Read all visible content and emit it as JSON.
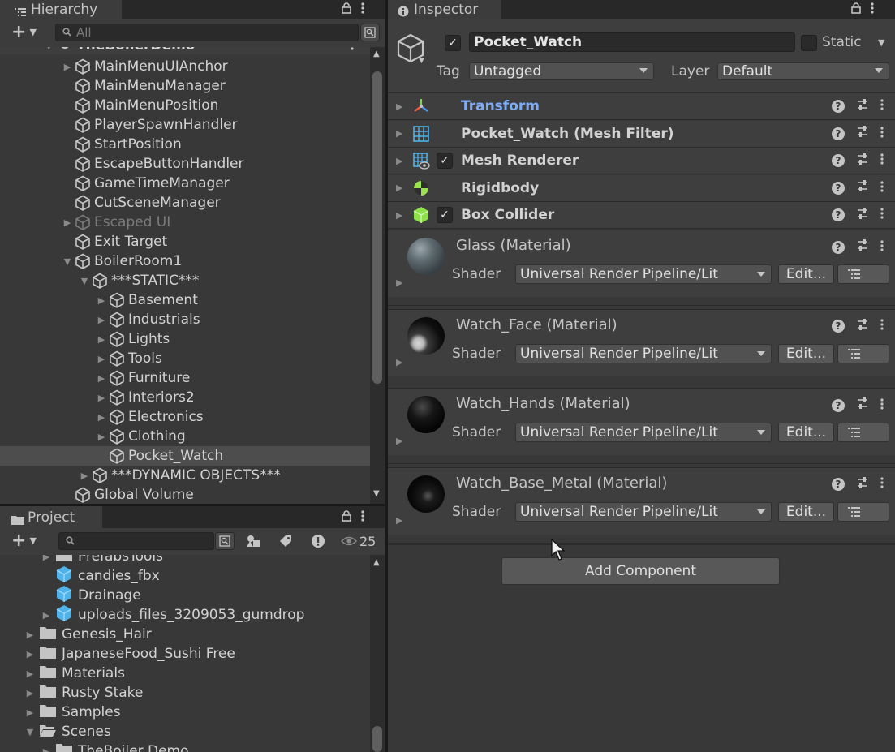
{
  "hierarchy": {
    "tab_label": "Hierarchy",
    "search_placeholder": "All",
    "scene_name": "TheBoilerDemo",
    "rows": [
      {
        "label": "MainMenuUIAnchor",
        "depth": 1,
        "arrow": "right",
        "dim": false,
        "selected": false
      },
      {
        "label": "MainMenuManager",
        "depth": 1,
        "arrow": "",
        "dim": false,
        "selected": false
      },
      {
        "label": "MainMenuPosition",
        "depth": 1,
        "arrow": "",
        "dim": false,
        "selected": false
      },
      {
        "label": "PlayerSpawnHandler",
        "depth": 1,
        "arrow": "",
        "dim": false,
        "selected": false
      },
      {
        "label": "StartPosition",
        "depth": 1,
        "arrow": "",
        "dim": false,
        "selected": false
      },
      {
        "label": "EscapeButtonHandler",
        "depth": 1,
        "arrow": "",
        "dim": false,
        "selected": false
      },
      {
        "label": "GameTimeManager",
        "depth": 1,
        "arrow": "",
        "dim": false,
        "selected": false
      },
      {
        "label": "CutSceneManager",
        "depth": 1,
        "arrow": "",
        "dim": false,
        "selected": false
      },
      {
        "label": "Escaped UI",
        "depth": 1,
        "arrow": "right",
        "dim": true,
        "selected": false
      },
      {
        "label": "Exit Target",
        "depth": 1,
        "arrow": "",
        "dim": false,
        "selected": false
      },
      {
        "label": "BoilerRoom1",
        "depth": 1,
        "arrow": "down",
        "dim": false,
        "selected": false
      },
      {
        "label": "***STATIC***",
        "depth": 2,
        "arrow": "down",
        "dim": false,
        "selected": false
      },
      {
        "label": "Basement",
        "depth": 3,
        "arrow": "right",
        "dim": false,
        "selected": false
      },
      {
        "label": "Industrials",
        "depth": 3,
        "arrow": "right",
        "dim": false,
        "selected": false
      },
      {
        "label": "Lights",
        "depth": 3,
        "arrow": "right",
        "dim": false,
        "selected": false
      },
      {
        "label": "Tools",
        "depth": 3,
        "arrow": "right",
        "dim": false,
        "selected": false
      },
      {
        "label": "Furniture",
        "depth": 3,
        "arrow": "right",
        "dim": false,
        "selected": false
      },
      {
        "label": "Interiors2",
        "depth": 3,
        "arrow": "right",
        "dim": false,
        "selected": false
      },
      {
        "label": "Electronics",
        "depth": 3,
        "arrow": "right",
        "dim": false,
        "selected": false
      },
      {
        "label": "Clothing",
        "depth": 3,
        "arrow": "right",
        "dim": false,
        "selected": false
      },
      {
        "label": "Pocket_Watch",
        "depth": 3,
        "arrow": "",
        "dim": false,
        "selected": true
      },
      {
        "label": "***DYNAMIC OBJECTS***",
        "depth": 2,
        "arrow": "right",
        "dim": false,
        "selected": false
      },
      {
        "label": "Global Volume",
        "depth": 1,
        "arrow": "",
        "dim": false,
        "selected": false
      }
    ]
  },
  "project": {
    "tab_label": "Project",
    "hidden_count": "25",
    "items": [
      {
        "label": "PrefabsTools",
        "indent": 1,
        "arrow": "right",
        "icon": "folder"
      },
      {
        "label": "candies_fbx",
        "indent": 1,
        "arrow": "",
        "icon": "model"
      },
      {
        "label": "Drainage",
        "indent": 1,
        "arrow": "",
        "icon": "model"
      },
      {
        "label": "uploads_files_3209053_gumdrop",
        "indent": 1,
        "arrow": "right",
        "icon": "model"
      },
      {
        "label": "Genesis_Hair",
        "indent": 0,
        "arrow": "right",
        "icon": "folder"
      },
      {
        "label": "JapaneseFood_Sushi Free",
        "indent": 0,
        "arrow": "right",
        "icon": "folder"
      },
      {
        "label": "Materials",
        "indent": 0,
        "arrow": "right",
        "icon": "folder"
      },
      {
        "label": "Rusty Stake",
        "indent": 0,
        "arrow": "right",
        "icon": "folder"
      },
      {
        "label": "Samples",
        "indent": 0,
        "arrow": "right",
        "icon": "folder"
      },
      {
        "label": "Scenes",
        "indent": 0,
        "arrow": "down",
        "icon": "folder-open"
      },
      {
        "label": "TheBoiler Demo",
        "indent": 1,
        "arrow": "right",
        "icon": "folder"
      }
    ]
  },
  "inspector": {
    "tab_label": "Inspector",
    "object_name": "Pocket_Watch",
    "static_label": "Static",
    "tag_label": "Tag",
    "tag_value": "Untagged",
    "layer_label": "Layer",
    "layer_value": "Default",
    "components": [
      {
        "name": "Transform",
        "icon": "transform-icon",
        "has_checkbox": false,
        "highlight": true
      },
      {
        "name": "Pocket_Watch (Mesh Filter)",
        "icon": "mesh-filter-icon",
        "has_checkbox": false,
        "highlight": false
      },
      {
        "name": "Mesh Renderer",
        "icon": "mesh-renderer-icon",
        "has_checkbox": true,
        "highlight": false
      },
      {
        "name": "Rigidbody",
        "icon": "rigidbody-icon",
        "has_checkbox": false,
        "highlight": false
      },
      {
        "name": "Box Collider",
        "icon": "box-collider-icon",
        "has_checkbox": true,
        "highlight": false
      }
    ],
    "materials": [
      {
        "title": "Glass (Material)",
        "shader_label": "Shader",
        "shader": "Universal Render Pipeline/Lit",
        "edit_label": "Edit...",
        "sphere": "glass"
      },
      {
        "title": "Watch_Face (Material)",
        "shader_label": "Shader",
        "shader": "Universal Render Pipeline/Lit",
        "edit_label": "Edit...",
        "sphere": "face"
      },
      {
        "title": "Watch_Hands (Material)",
        "shader_label": "Shader",
        "shader": "Universal Render Pipeline/Lit",
        "edit_label": "Edit...",
        "sphere": "hands"
      },
      {
        "title": "Watch_Base_Metal (Material)",
        "shader_label": "Shader",
        "shader": "Universal Render Pipeline/Lit",
        "edit_label": "Edit...",
        "sphere": "metal"
      }
    ],
    "add_component_label": "Add Component"
  },
  "colors": {
    "transform_highlight": "#7cacf8",
    "panel_bg": "#383838",
    "selected_row": "#4d4d4d"
  }
}
